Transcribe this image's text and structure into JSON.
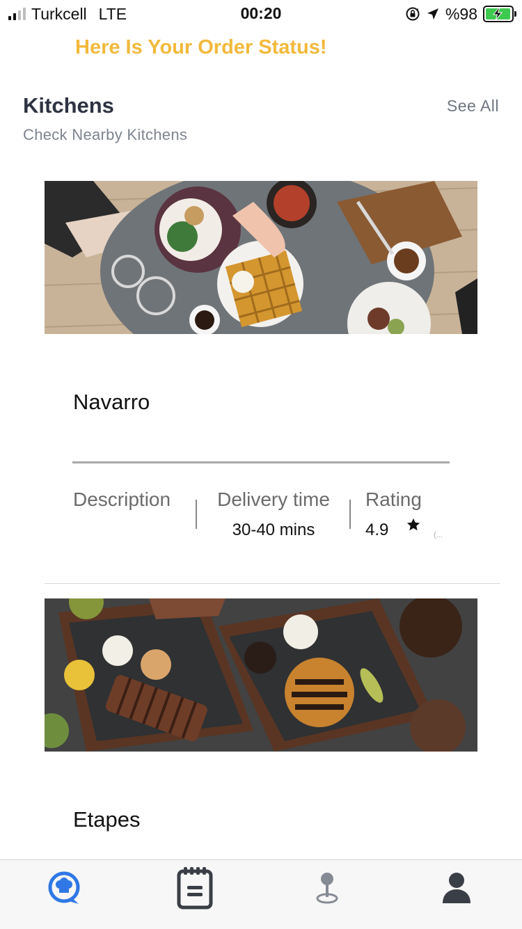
{
  "status_bar": {
    "carrier": "Turkcell",
    "network": "LTE",
    "time": "00:20",
    "battery_text": "%98"
  },
  "header": {
    "order_status": "Here Is Your Order Status!"
  },
  "section": {
    "title": "Kitchens",
    "subtitle": "Check Nearby Kitchens",
    "see_all": "See All"
  },
  "kitchens": [
    {
      "name": "Navarro",
      "description_label": "Description",
      "delivery_label": "Delivery time",
      "delivery_value": "30-40 mins",
      "rating_label": "Rating",
      "rating_value": "4.9",
      "rating_note": "(..."
    },
    {
      "name": "Etapes"
    }
  ],
  "tabbar": {
    "tabs": [
      {
        "icon": "chef-chat-icon",
        "active": true
      },
      {
        "icon": "orders-list-icon",
        "active": false
      },
      {
        "icon": "location-pin-icon",
        "active": false
      },
      {
        "icon": "profile-icon",
        "active": false
      }
    ]
  },
  "colors": {
    "accent_yellow": "#f2b93b",
    "title_dark": "#2d3341",
    "tab_active_blue": "#2f78e6",
    "tab_dark": "#3a3f47"
  }
}
